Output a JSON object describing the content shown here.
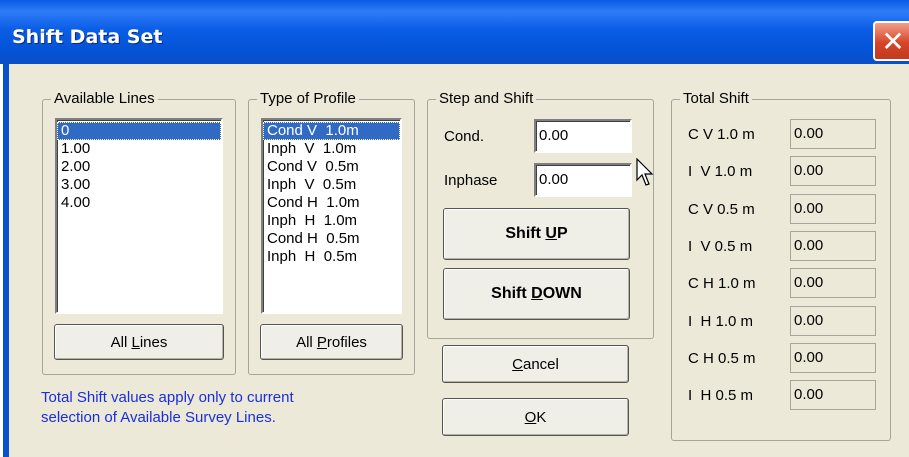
{
  "window": {
    "title": "Shift Data Set",
    "close_icon": "close-icon"
  },
  "available_lines": {
    "legend": "Available Lines",
    "items": [
      "0",
      "1.00",
      "2.00",
      "3.00",
      "4.00"
    ],
    "selected_index": 0,
    "button_prefix": "All ",
    "button_accel": "L",
    "button_suffix": "ines"
  },
  "type_of_profile": {
    "legend": "Type of Profile",
    "items": [
      "Cond V  1.0m",
      "Inph  V  1.0m",
      "Cond V  0.5m",
      "Inph  V  0.5m",
      "Cond H  1.0m",
      "Inph  H  1.0m",
      "Cond H  0.5m",
      "Inph  H  0.5m"
    ],
    "selected_index": 0,
    "button_prefix": "All ",
    "button_accel": "P",
    "button_suffix": "rofiles"
  },
  "step_and_shift": {
    "legend": "Step and Shift",
    "cond_label": "Cond.",
    "cond_value": "0.00",
    "inphase_label": "Inphase",
    "inphase_value": "0.00",
    "shift_up_prefix": "Shift ",
    "shift_up_accel": "U",
    "shift_up_suffix": "P",
    "shift_down_prefix": "Shift ",
    "shift_down_accel": "D",
    "shift_down_suffix": "OWN"
  },
  "actions": {
    "cancel_accel": "C",
    "cancel_suffix": "ancel",
    "ok_accel": "O",
    "ok_suffix": "K"
  },
  "total_shift": {
    "legend": "Total Shift",
    "rows": [
      {
        "label": "C V 1.0 m",
        "value": "0.00"
      },
      {
        "label": "I  V 1.0 m",
        "value": "0.00"
      },
      {
        "label": "C V 0.5 m",
        "value": "0.00"
      },
      {
        "label": "I  V 0.5 m",
        "value": "0.00"
      },
      {
        "label": "C H 1.0 m",
        "value": "0.00"
      },
      {
        "label": "I  H 1.0 m",
        "value": "0.00"
      },
      {
        "label": "C H 0.5 m",
        "value": "0.00"
      },
      {
        "label": "I  H 0.5 m",
        "value": "0.00"
      }
    ]
  },
  "note": {
    "line1": "Total Shift values apply only to current",
    "line2": "selection of Available Survey Lines."
  },
  "colors": {
    "title_bar": "#0454d8",
    "selection": "#316ac5",
    "note_text": "#1a2ee0",
    "dialog_bg": "#ece9d8"
  }
}
